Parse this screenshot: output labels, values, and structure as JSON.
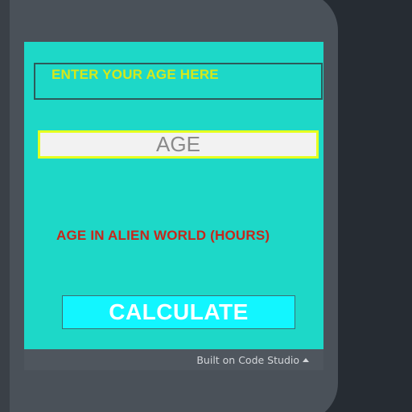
{
  "app": {
    "title_box_text": "ENTER YOUR AGE HERE",
    "age_input": {
      "placeholder": "AGE",
      "value": ""
    },
    "result_label": "AGE IN ALIEN WORLD (HOURS)",
    "calculate_button_label": "CALCULATE"
  },
  "footer": {
    "link_label": "Built on Code Studio",
    "link_icon": "caret-up-icon"
  },
  "colors": {
    "screen_background": "#1dd8c8",
    "title_text": "#d6e81a",
    "input_border": "#e6ff1f",
    "result_text": "#c6271c",
    "button_background": "#12f6ff",
    "footer_background": "#4f565e"
  }
}
